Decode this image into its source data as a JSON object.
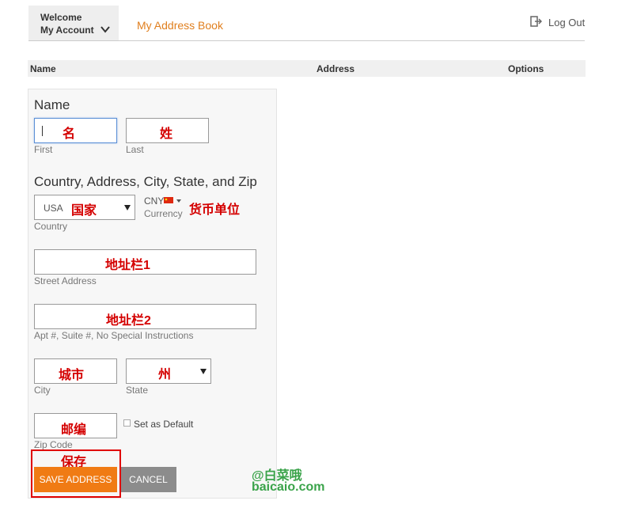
{
  "header": {
    "welcome": "Welcome",
    "my_account": "My Account",
    "address_book": "My Address Book",
    "logout": "Log Out"
  },
  "table": {
    "columns": [
      "Name",
      "Address",
      "Options"
    ]
  },
  "form": {
    "name_title": "Name",
    "first_hint": "First",
    "last_hint": "Last",
    "first_note": "名",
    "last_note": "姓",
    "country_title": "Country, Address, City, State, and Zip",
    "country_value": "USA",
    "country_note": "国家",
    "country_hint": "Country",
    "currency_value": "CNY",
    "currency_hint": "Currency",
    "currency_note": "货币单位",
    "street_note": "地址栏1",
    "street_hint": "Street Address",
    "apt_note": "地址栏2",
    "apt_hint": "Apt #, Suite #, No Special Instructions",
    "city_note": "城市",
    "city_hint": "City",
    "state_note": "州",
    "state_hint": "State",
    "zip_note": "邮编",
    "zip_hint": "Zip Code",
    "default_label": "Set as Default",
    "save_note": "保存",
    "save_label": "SAVE ADDRESS",
    "cancel_label": "CANCEL"
  },
  "watermark": {
    "line1": "@白菜哦",
    "line2": "baicaio.com"
  },
  "colors": {
    "accent": "#f07b14",
    "annotation": "#d40000",
    "watermark": "#3aa34a"
  }
}
